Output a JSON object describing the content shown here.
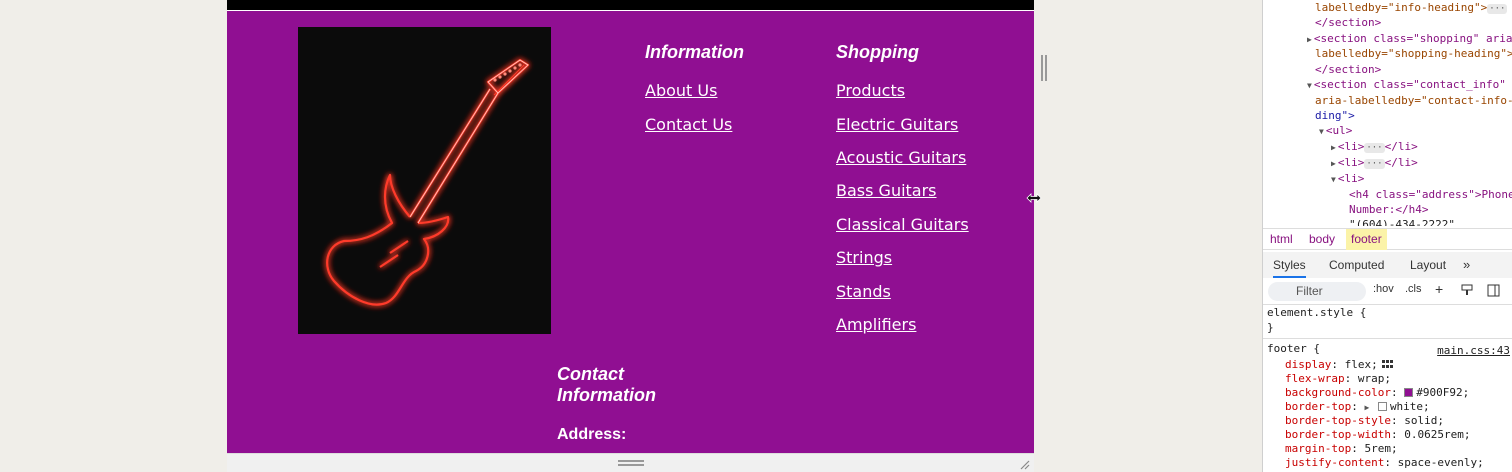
{
  "footer": {
    "background": "#900f92",
    "image_alt": "neon-guitar",
    "info": {
      "heading": "Information",
      "links": [
        "About Us",
        "Contact Us"
      ]
    },
    "shopping": {
      "heading": "Shopping",
      "links": [
        "Products",
        "Electric Guitars",
        "Acoustic Guitars",
        "Bass Guitars",
        "Classical Guitars",
        "Strings",
        "Stands",
        "Amplifiers"
      ]
    },
    "contact": {
      "heading_line1": "Contact",
      "heading_line2": "Information",
      "address_label": "Address:"
    }
  },
  "devtools": {
    "dom": [
      {
        "t": "labelledby=\"info-heading\">"
      },
      {
        "t": "</section>"
      },
      {
        "t": "<section class=\"shopping\" aria-"
      },
      {
        "t": "labelledby=\"shopping-heading\">"
      },
      {
        "t": "</section>"
      },
      {
        "t": "<section class=\"contact_info\""
      },
      {
        "t": "aria-labelledby=\"contact-info-"
      },
      {
        "t": "ding\">"
      },
      {
        "t": "<ul>"
      },
      {
        "t": "<li>"
      },
      {
        "t": "<li>"
      },
      {
        "t": "<li>"
      },
      {
        "t": "<h4 class=\"address\">Phone"
      },
      {
        "t": "Number:</h4>"
      },
      {
        "t": "\"(604)-434-2222\""
      }
    ],
    "breadcrumb": [
      "html",
      "body",
      "footer"
    ],
    "tabs": [
      "Styles",
      "Computed",
      "Layout"
    ],
    "filter_placeholder": "Filter",
    "toolbar": {
      "hov": ":hov",
      "cls": ".cls"
    },
    "element_style": "element.style {",
    "close_brace": "}",
    "rule_selector": "footer {",
    "rule_source": "main.css:43",
    "props": [
      {
        "name": "display",
        "value": "flex;"
      },
      {
        "name": "flex-wrap",
        "value": "wrap;"
      },
      {
        "name": "background-color",
        "value": "#900F92;"
      },
      {
        "name": "border-top",
        "value": "white;"
      },
      {
        "name": "border-top-style",
        "value": "solid;"
      },
      {
        "name": "border-top-width",
        "value": "0.0625rem;"
      },
      {
        "name": "margin-top",
        "value": "5rem;"
      },
      {
        "name": "justify-content",
        "value": "space-evenly;"
      }
    ]
  }
}
